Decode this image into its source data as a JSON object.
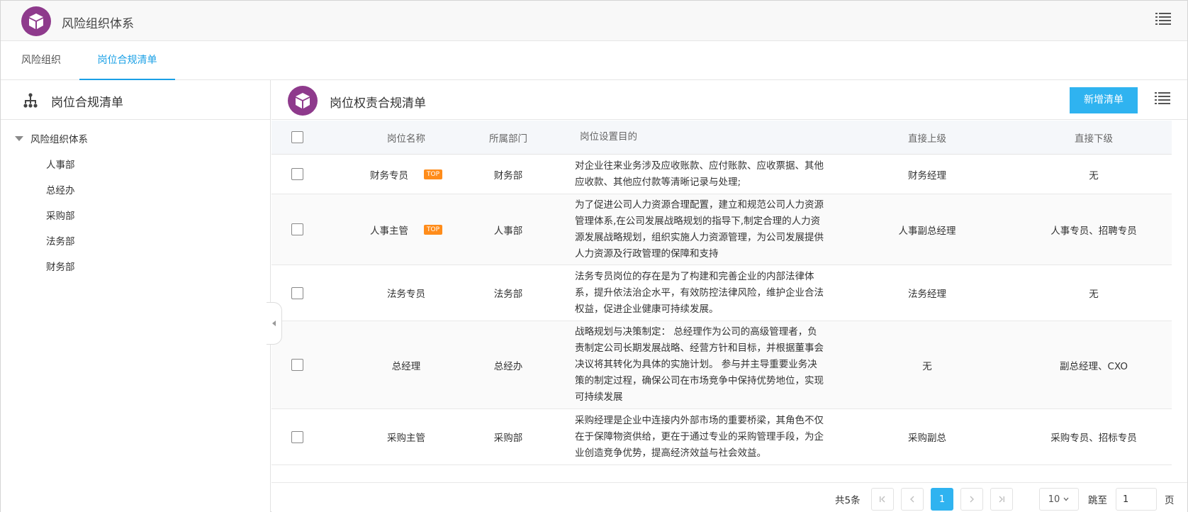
{
  "header": {
    "title": "风险组织体系",
    "menu_icon": "list-menu-icon",
    "logo_icon": "cube-icon",
    "logo_color": "#8e3a8c"
  },
  "tabs": [
    {
      "label": "风险组织",
      "active": false
    },
    {
      "label": "岗位合规清单",
      "active": true
    }
  ],
  "accent_color": "#1aa0e6",
  "left_panel": {
    "title": "岗位合规清单",
    "icon": "org-chart-icon",
    "tree": {
      "root": "风险组织体系",
      "children": [
        "人事部",
        "总经办",
        "采购部",
        "法务部",
        "财务部"
      ]
    }
  },
  "right_panel": {
    "title": "岗位权责合规清单",
    "add_button": "新增清单",
    "table": {
      "headers": {
        "name": "岗位名称",
        "dept": "所属部门",
        "purpose": "岗位设置目的",
        "superior": "直接上级",
        "subordinate": "直接下级"
      },
      "rows": [
        {
          "name": "财务专员",
          "badge": "TOP",
          "dept": "财务部",
          "purpose": "对企业往来业务涉及应收账款、应付账款、应收票据、其他应收款、其他应付款等清晰记录与处理;",
          "superior": "财务经理",
          "subordinate": "无"
        },
        {
          "name": "人事主管",
          "badge": "TOP",
          "dept": "人事部",
          "purpose": "为了促进公司人力资源合理配置，建立和规范公司人力资源管理体系,在公司发展战略规划的指导下,制定合理的人力资源发展战略规划，组织实施人力资源管理，为公司发展提供人力资源及行政管理的保障和支持",
          "superior": "人事副总经理",
          "subordinate": "人事专员、招聘专员"
        },
        {
          "name": "法务专员",
          "badge": "",
          "dept": "法务部",
          "purpose": "法务专员岗位的存在是为了构建和完善企业的内部法律体系，提升依法治企水平，有效防控法律风险，维护企业合法权益，促进企业健康可持续发展。",
          "superior": "法务经理",
          "subordinate": "无"
        },
        {
          "name": "总经理",
          "badge": "",
          "dept": "总经办",
          "purpose": "战略规划与决策制定： 总经理作为公司的高级管理者，负责制定公司长期发展战略、经营方针和目标，并根据董事会决议将其转化为具体的实施计划。 参与并主导重要业务决策的制定过程，确保公司在市场竞争中保持优势地位，实现可持续发展",
          "superior": "无",
          "subordinate": "副总经理、CXO"
        },
        {
          "name": "采购主管",
          "badge": "",
          "dept": "采购部",
          "purpose": "采购经理是企业中连接内外部市场的重要桥梁，其角色不仅在于保障物资供给，更在于通过专业的采购管理手段，为企业创造竞争优势，提高经济效益与社会效益。",
          "superior": "采购副总",
          "subordinate": "采购专员、招标专员"
        }
      ]
    },
    "pagination": {
      "total": "共5条",
      "current_page": "1",
      "page_size": "10",
      "jump_label": "跳至",
      "jump_value": "1",
      "page_label": "页"
    }
  },
  "button_color": "#2fb3f0",
  "badge_color": "#ff8c1a"
}
